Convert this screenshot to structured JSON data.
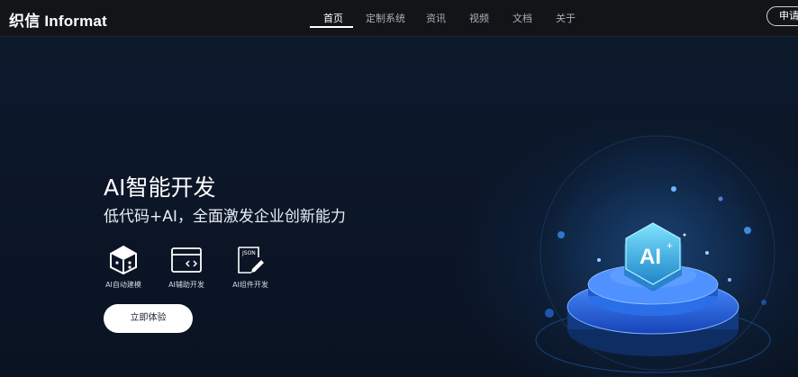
{
  "brand": {
    "logo_text": "织信 Informat"
  },
  "nav": {
    "items": [
      {
        "label": "首页",
        "active": true
      },
      {
        "label": "定制系统",
        "active": false
      },
      {
        "label": "资讯",
        "active": false
      },
      {
        "label": "视频",
        "active": false
      },
      {
        "label": "文档",
        "active": false
      },
      {
        "label": "关于",
        "active": false
      }
    ],
    "apply_label": "申请试用"
  },
  "hero": {
    "title": "AI智能开发",
    "subtitle": "低代码+AI，全面激发企业创新能力",
    "features": [
      {
        "label": "AI自动建模",
        "icon": "cube-icon"
      },
      {
        "label": "AI辅助开发",
        "icon": "code-window-icon"
      },
      {
        "label": "AI组件开发",
        "icon": "json-edit-icon"
      }
    ],
    "cta_label": "立即体验",
    "illustration": {
      "badge_text": "AI",
      "badge_sup": "+",
      "icon": "ai-platform-icon"
    }
  },
  "colors": {
    "background": "#0b1424",
    "topbar": "#121417",
    "accent": "#2f7cff",
    "badge": "#3fb8e6"
  }
}
